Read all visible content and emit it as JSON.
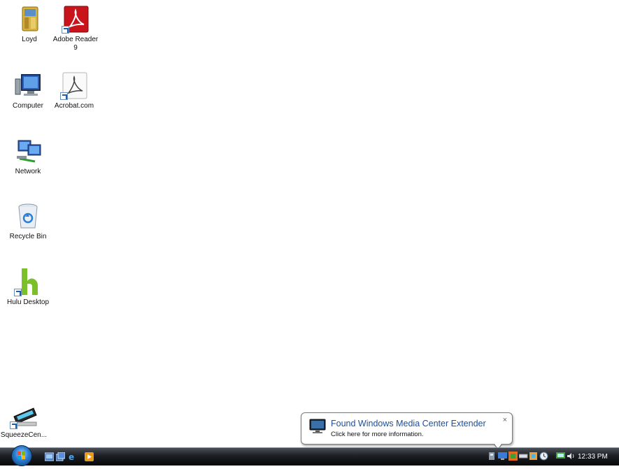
{
  "desktop": {
    "icons": [
      {
        "name": "loyd",
        "label": "Loyd"
      },
      {
        "name": "adobe-reader-9",
        "label": "Adobe Reader 9"
      },
      {
        "name": "computer",
        "label": "Computer"
      },
      {
        "name": "acrobat-com",
        "label": "Acrobat.com"
      },
      {
        "name": "network",
        "label": "Network"
      },
      {
        "name": "recycle-bin",
        "label": "Recycle Bin"
      },
      {
        "name": "hulu-desktop",
        "label": "Hulu Desktop"
      },
      {
        "name": "squeezecenter",
        "label": "SqueezeCen..."
      }
    ]
  },
  "notification": {
    "title": "Found Windows Media Center Extender",
    "text": "Click here for more information.",
    "close": "×",
    "icon": "monitor-icon"
  },
  "taskbar": {
    "start_icon": "windows-orb-icon",
    "quick_launch": [
      "show-desktop-icon",
      "switch-windows-icon",
      "internet-explorer-icon",
      "media-player-icon"
    ],
    "tray_icons": [
      "network-tray-icon",
      "monitor-tray-icon",
      "media-center-tray-icon",
      "battery-icon",
      "sync-icon",
      "clock-app-icon",
      "display-icon",
      "volume-icon"
    ],
    "clock": "12:33 PM"
  },
  "colors": {
    "balloon_title": "#1c4ea1",
    "taskbar": "#1c1f24",
    "adobe_red": "#c8141a",
    "hulu_green": "#7bbf2a"
  }
}
